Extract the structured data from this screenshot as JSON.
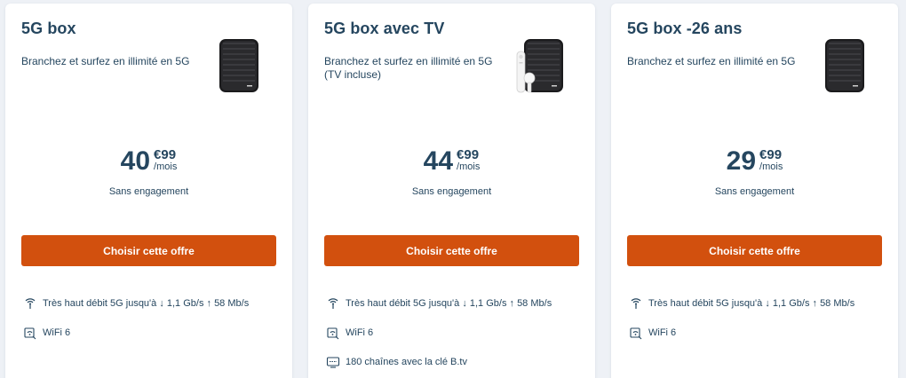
{
  "offers": [
    {
      "title": "5G box",
      "description": "Branchez et surfez en illimité en 5G",
      "image_alt": "5g-box-product-image",
      "price": {
        "amount": "40",
        "cents": "€99",
        "period": "/mois"
      },
      "commitment": "Sans engagement",
      "cta": "Choisir cette offre",
      "features": [
        {
          "icon": "5g-antenna-icon",
          "text": "Très haut débit 5G jusqu'à ↓ 1,1 Gb/s  ↑ 58 Mb/s"
        },
        {
          "icon": "wifi-icon",
          "text": "WiFi 6"
        }
      ]
    },
    {
      "title": "5G box avec TV",
      "description": "Branchez et surfez en illimité en 5G (TV incluse)",
      "image_alt": "5g-box-with-tv-key-image",
      "price": {
        "amount": "44",
        "cents": "€99",
        "period": "/mois"
      },
      "commitment": "Sans engagement",
      "cta": "Choisir cette offre",
      "features": [
        {
          "icon": "5g-antenna-icon",
          "text": "Très haut débit 5G jusqu'à ↓ 1,1 Gb/s  ↑ 58 Mb/s"
        },
        {
          "icon": "wifi-icon",
          "text": "WiFi 6"
        },
        {
          "icon": "tv-icon",
          "text": "180 chaînes avec la clé B.tv"
        }
      ]
    },
    {
      "title": "5G box -26 ans",
      "description": "Branchez et surfez en illimité en 5G",
      "image_alt": "5g-box-product-image",
      "price": {
        "amount": "29",
        "cents": "€99",
        "period": "/mois"
      },
      "commitment": "Sans engagement",
      "cta": "Choisir cette offre",
      "features": [
        {
          "icon": "5g-antenna-icon",
          "text": "Très haut débit 5G jusqu'à ↓ 1,1 Gb/s  ↑ 58 Mb/s"
        },
        {
          "icon": "wifi-icon",
          "text": "WiFi 6"
        }
      ]
    }
  ],
  "colors": {
    "text": "#25465f",
    "cta": "#d2500e",
    "background": "#eef1f6",
    "card": "#ffffff"
  }
}
